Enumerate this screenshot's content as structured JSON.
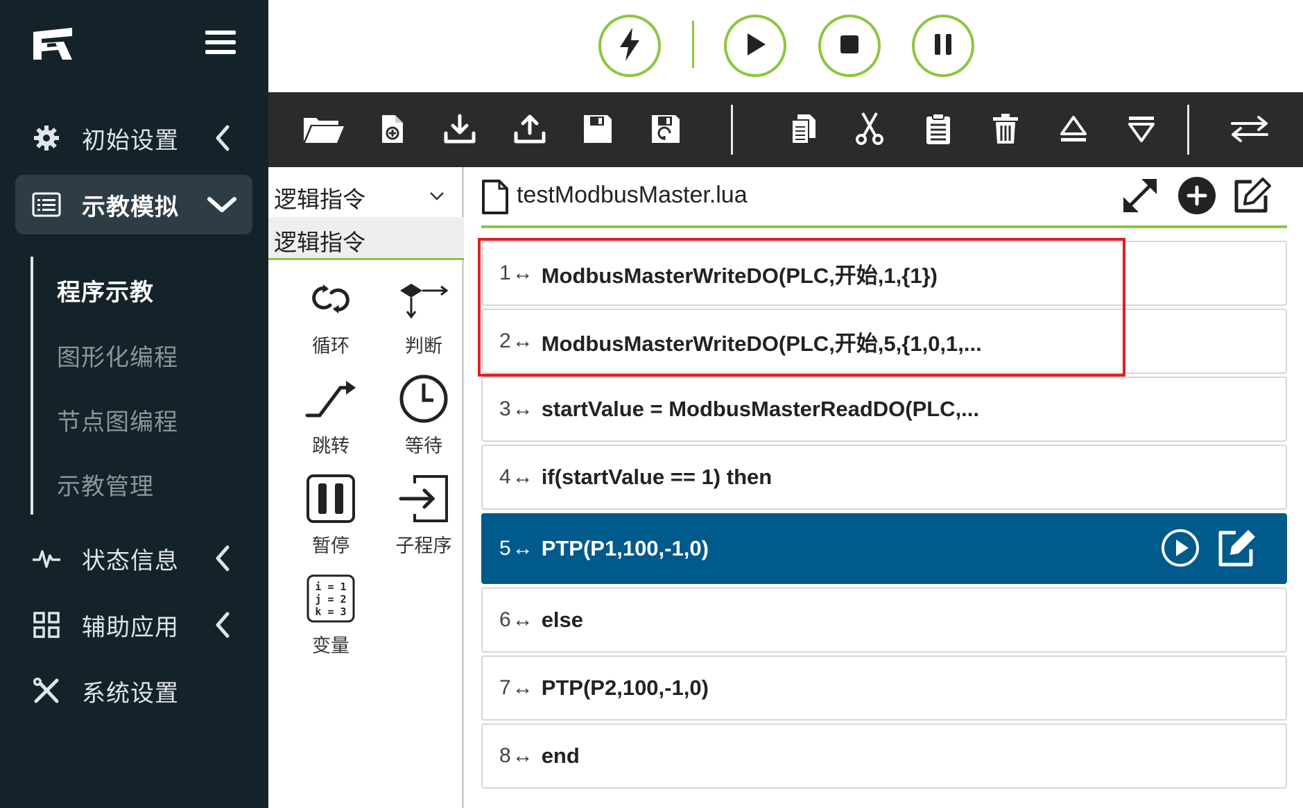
{
  "sidebar": {
    "logo": "fairino-logo",
    "menu_icon": "hamburger-icon",
    "nav": [
      {
        "label": "初始设置",
        "icon": "gear-icon"
      },
      {
        "label": "示教模拟",
        "icon": "list-icon"
      },
      {
        "label": "状态信息",
        "icon": "pulse-icon"
      },
      {
        "label": "辅助应用",
        "icon": "grid-icon"
      },
      {
        "label": "系统设置",
        "icon": "tools-icon"
      }
    ],
    "subnav": [
      {
        "label": "程序示教"
      },
      {
        "label": "图形化编程"
      },
      {
        "label": "节点图编程"
      },
      {
        "label": "示教管理"
      }
    ]
  },
  "controls": {
    "accent": "#8cc63f",
    "buttons": [
      "enable-icon",
      "play-icon",
      "stop-icon",
      "pause-icon"
    ]
  },
  "toolbar": {
    "background": "#2b2b2b",
    "icons": [
      "folder-open-icon",
      "new-file-icon",
      "download-icon",
      "upload-icon",
      "save-icon",
      "save-as-icon",
      "copy-icon",
      "cut-icon",
      "paste-icon",
      "delete-icon",
      "move-up-icon",
      "move-down-icon",
      "swap-icon"
    ]
  },
  "palette": {
    "select_value": "逻辑指令",
    "category": "逻辑指令",
    "items": [
      {
        "label": "循环",
        "icon": "loop-icon"
      },
      {
        "label": "判断",
        "icon": "branch-icon"
      },
      {
        "label": "跳转",
        "icon": "jump-icon"
      },
      {
        "label": "等待",
        "icon": "clock-icon"
      },
      {
        "label": "暂停",
        "icon": "pause-box-icon"
      },
      {
        "label": "子程序",
        "icon": "subprogram-icon"
      },
      {
        "label": "变量",
        "icon": "variable-icon"
      }
    ],
    "variable_icon_text": [
      "i = 1",
      "j = 2",
      "k = 3"
    ]
  },
  "editor": {
    "file_name": "testModbusMaster.lua",
    "selected_color": "#005a8c",
    "highlight_color": "#e11f26",
    "rows": [
      {
        "num": "1",
        "code": "ModbusMasterWriteDO(PLC,开始,1,{1})"
      },
      {
        "num": "2",
        "code": "ModbusMasterWriteDO(PLC,开始,5,{1,0,1,..."
      },
      {
        "num": "3",
        "code": "startValue = ModbusMasterReadDO(PLC,..."
      },
      {
        "num": "4",
        "code": "if(startValue == 1) then"
      },
      {
        "num": "5",
        "code": "PTP(P1,100,-1,0)"
      },
      {
        "num": "6",
        "code": "else"
      },
      {
        "num": "7",
        "code": "PTP(P2,100,-1,0)"
      },
      {
        "num": "8",
        "code": "end"
      }
    ],
    "arrow": "↔"
  }
}
